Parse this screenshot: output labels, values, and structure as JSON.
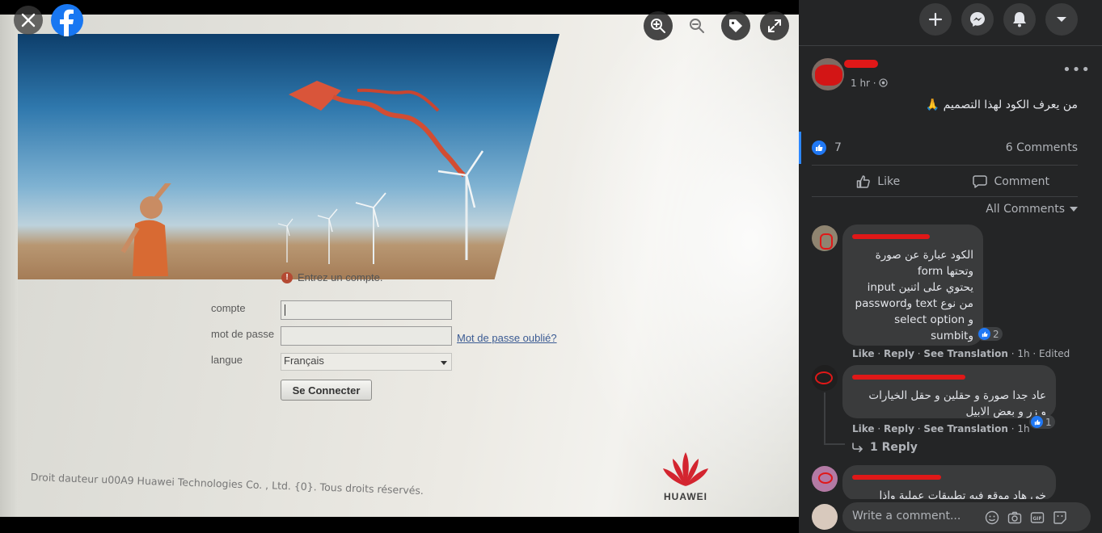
{
  "viewer": {
    "close_icon": "close-icon",
    "logo_icon": "facebook-logo",
    "tools": [
      "zoom-in-icon",
      "zoom-out-icon",
      "tag-icon",
      "fullscreen-icon"
    ]
  },
  "photo": {
    "error_text": "Entrez un compte.",
    "label_account": "compte",
    "label_password": "mot de passe",
    "label_language": "langue",
    "forgot_link": "Mot de passe oublié?",
    "language_value": "Français",
    "login_button": "Se Connecter",
    "copyright": "Droit dauteur u00A9 Huawei Technologies Co. , Ltd. {0}. Tous droits réservés.",
    "brand": "HUAWEI"
  },
  "panel": {
    "header_icons": [
      "plus-icon",
      "messenger-icon",
      "bell-icon",
      "caret-down-icon"
    ],
    "post": {
      "time": "1 hr ·",
      "text": "من يعرف الكود لهذا التصميم 🙏",
      "likes": "7",
      "comments": "6 Comments",
      "like_label": "Like",
      "comment_label": "Comment",
      "filter": "All Comments"
    },
    "comments": [
      {
        "lines": [
          "الكود عبارة عن صورة",
          "وتحتها form",
          "يحتوي على اثنين input",
          "من نوع text وpassword",
          "و select option",
          "وsumbit"
        ],
        "reactions": "2",
        "meta": {
          "like": "Like",
          "reply": "Reply",
          "translate": "See Translation",
          "time": "1h",
          "edited": "Edited"
        }
      },
      {
        "lines": [
          "عاد جدا صورة و حقلين و حقل الخيارات",
          "و زر و بعض الابيل"
        ],
        "reactions": "1",
        "meta": {
          "like": "Like",
          "reply": "Reply",
          "translate": "See Translation",
          "time": "1h"
        }
      },
      {
        "lines": [
          "خى هاد موقع فيه تطبيقات عملية واذا"
        ]
      }
    ],
    "replies_link": "1 Reply",
    "write_placeholder": "Write a comment..."
  },
  "colors": {
    "accent": "#2078f4",
    "panel_bg": "#242526",
    "bubble_bg": "#3a3b3c",
    "redaction": "#e01818"
  }
}
